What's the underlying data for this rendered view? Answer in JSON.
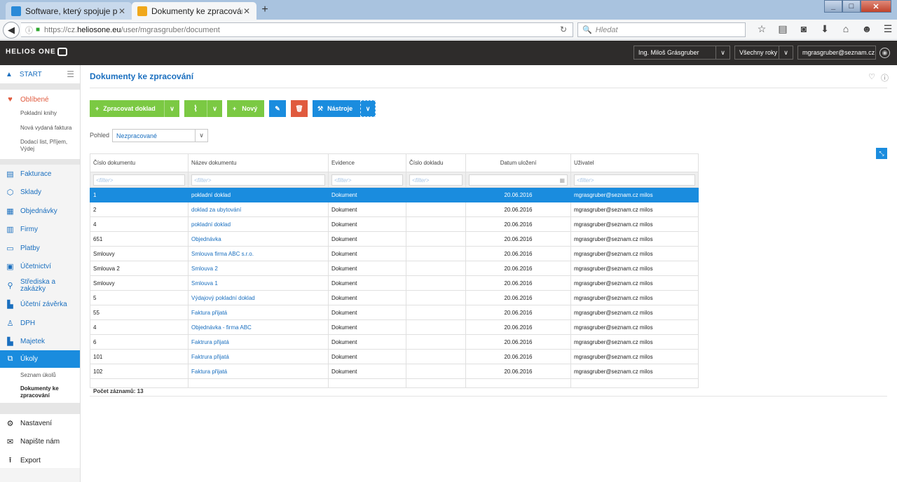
{
  "browser": {
    "tabs": [
      {
        "title": "Software, který spojuje po...",
        "color": "#2a8ad8"
      },
      {
        "title": "Dokumenty ke zpracování ...",
        "color": "#f0a81c"
      }
    ],
    "url_prefix": "https://cz.",
    "url_host": "heliosone.eu",
    "url_path": "/user/mgrasgruber/document",
    "search_placeholder": "Hledat"
  },
  "header": {
    "logo": "HELIOS ONE",
    "user": "Ing. Miloš Grásgruber",
    "years": "Všechny roky",
    "email": "mgrasgruber@seznam.cz"
  },
  "sidebar": {
    "start": "START",
    "favorites_label": "Oblíbené",
    "favorites": [
      "Pokladní knihy",
      "Nová vydaná faktura",
      "Dodací list, Příjem, Výdej"
    ],
    "items": [
      {
        "label": "Fakturace",
        "icon": "invoice-icon"
      },
      {
        "label": "Sklady",
        "icon": "box-icon"
      },
      {
        "label": "Objednávky",
        "icon": "order-icon"
      },
      {
        "label": "Firmy",
        "icon": "company-icon"
      },
      {
        "label": "Platby",
        "icon": "payment-icon"
      },
      {
        "label": "Účetnictví",
        "icon": "ledger-icon"
      },
      {
        "label": "Střediska a zakázky",
        "icon": "org-icon"
      },
      {
        "label": "Účetní závěrka",
        "icon": "closing-icon"
      },
      {
        "label": "DPH",
        "icon": "tax-icon"
      },
      {
        "label": "Majetek",
        "icon": "assets-icon"
      },
      {
        "label": "Úkoly",
        "icon": "tasks-icon"
      }
    ],
    "tasks_sub": [
      "Seznam úkolů",
      "Dokumenty ke zpracování"
    ],
    "bottom": [
      {
        "label": "Nastavení",
        "icon": "gear-icon"
      },
      {
        "label": "Napište nám",
        "icon": "mail-icon"
      },
      {
        "label": "Export",
        "icon": "export-icon"
      }
    ]
  },
  "page": {
    "title": "Dokumenty ke zpracování",
    "toolbar": {
      "process": "Zpracovat doklad",
      "new": "Nový",
      "tools": "Nástroje"
    },
    "view_label": "Pohled",
    "view_value": "Nezpracované",
    "filter_placeholder": "<filter>",
    "columns": [
      "Číslo dokumentu",
      "Název dokumentu",
      "Evidence",
      "Číslo dokladu",
      "Datum uložení",
      "Uživatel"
    ],
    "rows": [
      [
        "1",
        "pokladní doklad",
        "Dokument",
        "",
        "20.06.2016",
        "mgrasgruber@seznam.cz milos"
      ],
      [
        "2",
        "doklad za ubytování",
        "Dokument",
        "",
        "20.06.2016",
        "mgrasgruber@seznam.cz milos"
      ],
      [
        "4",
        "pokladní doklad",
        "Dokument",
        "",
        "20.06.2016",
        "mgrasgruber@seznam.cz milos"
      ],
      [
        "651",
        "Objednávka",
        "Dokument",
        "",
        "20.06.2016",
        "mgrasgruber@seznam.cz milos"
      ],
      [
        "Smlouvy",
        "Smlouva firma ABC s.r.o.",
        "Dokument",
        "",
        "20.06.2016",
        "mgrasgruber@seznam.cz milos"
      ],
      [
        "Smlouva 2",
        "Smlouva 2",
        "Dokument",
        "",
        "20.06.2016",
        "mgrasgruber@seznam.cz milos"
      ],
      [
        "Smlouvy",
        "Smlouva 1",
        "Dokument",
        "",
        "20.06.2016",
        "mgrasgruber@seznam.cz milos"
      ],
      [
        "5",
        "Výdajový pokladní doklad",
        "Dokument",
        "",
        "20.06.2016",
        "mgrasgruber@seznam.cz milos"
      ],
      [
        "55",
        "Faktura přijatá",
        "Dokument",
        "",
        "20.06.2016",
        "mgrasgruber@seznam.cz milos"
      ],
      [
        "4",
        "Objednávka - firma ABC",
        "Dokument",
        "",
        "20.06.2016",
        "mgrasgruber@seznam.cz milos"
      ],
      [
        "6",
        "Faktrura přijatá",
        "Dokument",
        "",
        "20.06.2016",
        "mgrasgruber@seznam.cz milos"
      ],
      [
        "101",
        "Faktrura přijatá",
        "Dokument",
        "",
        "20.06.2016",
        "mgrasgruber@seznam.cz milos"
      ],
      [
        "102",
        "Faktura přijatá",
        "Dokument",
        "",
        "20.06.2016",
        "mgrasgruber@seznam.cz milos"
      ]
    ],
    "selected_row": 0,
    "count_text": "Počet záznamů: 13"
  },
  "colors": {
    "accent": "#1a8cde",
    "green": "#7bc943",
    "danger": "#e05a3e",
    "header": "#2e2c2b"
  }
}
